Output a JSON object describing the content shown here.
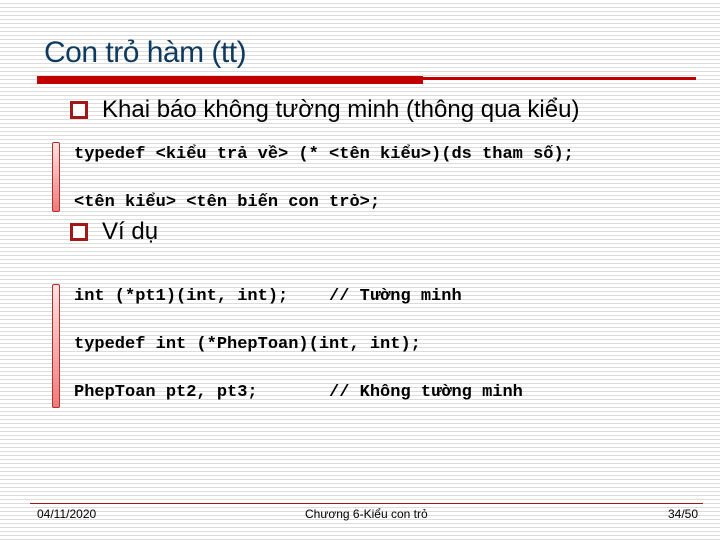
{
  "slide": {
    "title": "Con trỏ hàm (tt)",
    "bullets": [
      {
        "icon": "hollow-square-bullet",
        "text": "Khai báo không tường minh (thông qua kiểu)"
      },
      {
        "icon": "hollow-square-bullet",
        "text": "Ví dụ"
      }
    ],
    "code_block_1": [
      "typedef <kiểu trả về> (* <tên kiểu>)(ds tham số);",
      "<tên kiểu> <tên biến con trỏ>;"
    ],
    "code_block_2": [
      "int (*pt1)(int, int);    // Tường minh",
      "typedef int (*PhepToan)(int, int);",
      "PhepToan pt2, pt3;       // Không tường minh"
    ]
  },
  "footer": {
    "date": "04/11/2020",
    "chapter": "Chương 6-Kiểu con trỏ",
    "page": "34/50"
  },
  "colors": {
    "title": "#0f3a5f",
    "accent_red": "#c00000",
    "bullet_border": "#a01818"
  }
}
